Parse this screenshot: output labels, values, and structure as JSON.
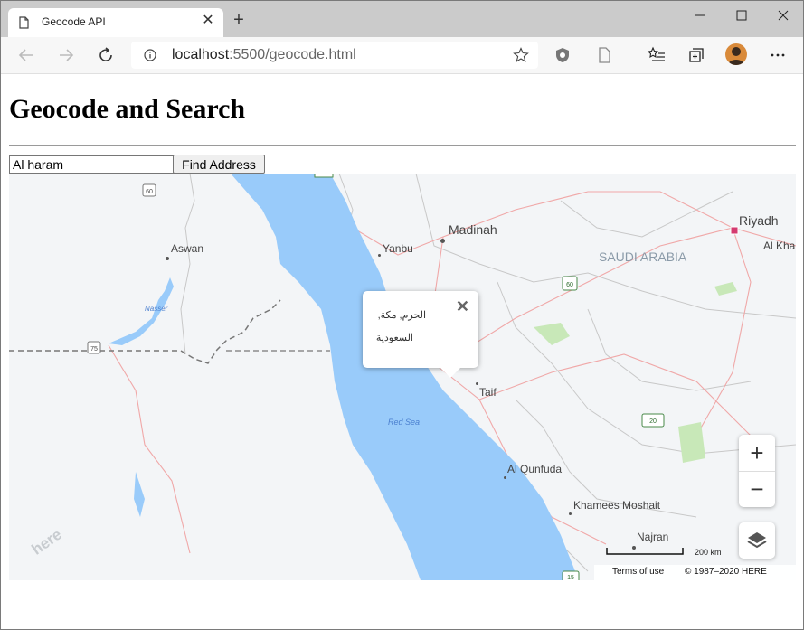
{
  "browser": {
    "tab_title": "Geocode API",
    "url_host": "localhost",
    "url_rest": ":5500/geocode.html"
  },
  "page": {
    "heading": "Geocode and Search",
    "search_value": "Al haram",
    "find_button_label": "Find Address"
  },
  "map": {
    "labels": {
      "madinah": "Madinah",
      "riyadh": "Riyadh",
      "al_kha": "Al Kha",
      "yanbu": "Yanbu",
      "aswan": "Aswan",
      "saudi_arabia": "SAUDI ARABIA",
      "nasser": "Nasser",
      "taif": "Taif",
      "red_sea": "Red Sea",
      "al_qunfuda": "Al Qunfuda",
      "khamees_moshait": "Khamees Moshait",
      "najran": "Najran"
    },
    "road_shields": [
      "60",
      "75",
      "60",
      "20",
      "15"
    ],
    "popup": {
      "line1": "الحرم, مكة,",
      "line2": "السعودية"
    },
    "scale_label": "200 km",
    "terms_label": "Terms of use",
    "copyright": "© 1987–2020 HERE",
    "logo_text": "here",
    "colors": {
      "water": "#99cbfa",
      "land": "#f3f5f7",
      "road_pink": "#f0a0a0",
      "border": "#9a9a9a"
    }
  }
}
